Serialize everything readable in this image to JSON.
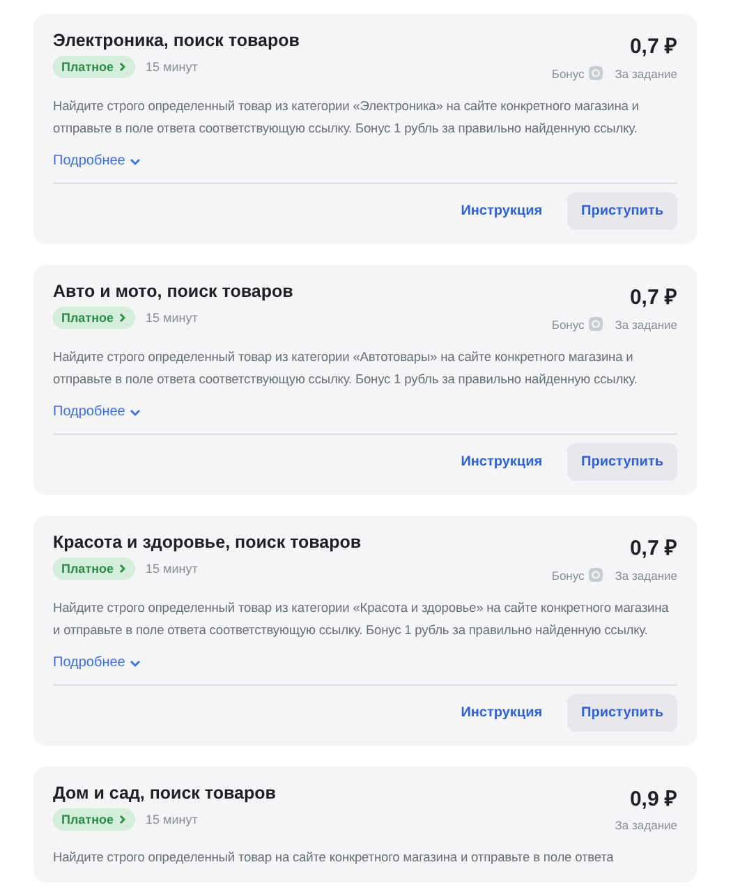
{
  "tasks": [
    {
      "title": "Электроника, поиск товаров",
      "price": "0,7 ₽",
      "badge": "Платное",
      "duration": "15 минут",
      "bonus_label": "Бонус",
      "per_label": "За задание",
      "description": "Найдите строго определенный товар из категории «Электроника» на сайте конкретного магазина и отправьте в поле ответа соответствующую ссылку. Бонус 1 рубль за правильно найденную ссылку.",
      "more": "Подробнее",
      "instruction": "Инструкция",
      "start": "Приступить"
    },
    {
      "title": "Авто и мото, поиск товаров",
      "price": "0,7 ₽",
      "badge": "Платное",
      "duration": "15 минут",
      "bonus_label": "Бонус",
      "per_label": "За задание",
      "description": "Найдите строго определенный товар из категории «Автотовары» на сайте конкретного магазина и отправьте в поле ответа соответствующую ссылку. Бонус 1 рубль за правильно найденную ссылку.",
      "more": "Подробнее",
      "instruction": "Инструкция",
      "start": "Приступить"
    },
    {
      "title": "Красота и здоровье, поиск товаров",
      "price": "0,7 ₽",
      "badge": "Платное",
      "duration": "15 минут",
      "bonus_label": "Бонус",
      "per_label": "За задание",
      "description": "Найдите строго определенный товар из категории «Красота и здоровье» на сайте конкретного магазина и отправьте в поле ответа соответствующую ссылку. Бонус 1 рубль за правильно найденную ссылку.",
      "more": "Подробнее",
      "instruction": "Инструкция",
      "start": "Приступить"
    },
    {
      "title": "Дом и сад, поиск товаров",
      "price": "0,9 ₽",
      "badge": "Платное",
      "duration": "15 минут",
      "per_label": "За задание",
      "description": "Найдите строго определенный товар на сайте конкретного магазина и отправьте в поле ответа"
    }
  ]
}
